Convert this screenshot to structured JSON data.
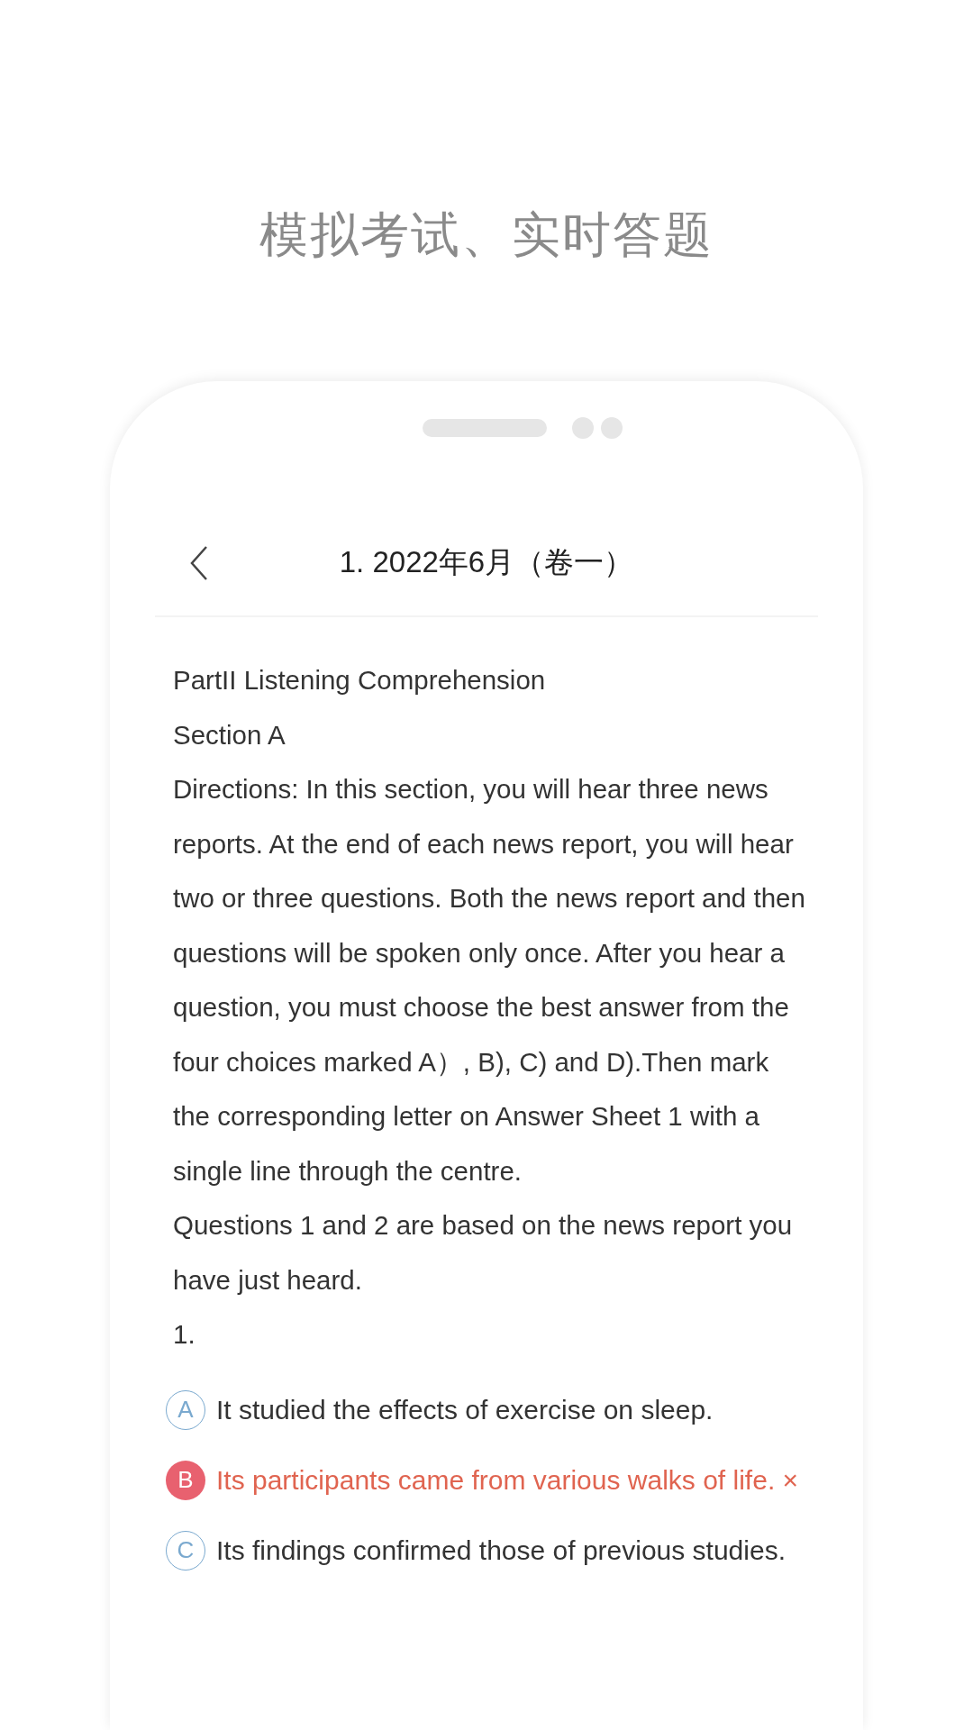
{
  "headline": "模拟考试、实时答题",
  "screen": {
    "title": "1. 2022年6月（卷一）",
    "paragraphs": [
      "PartII Listening Comprehension",
      "Section A",
      "Directions: In this section, you will hear three news reports. At the end of each news report, you will hear two or three questions. Both the news report and then questions will be spoken only once. After you hear a question, you must choose the best answer from the four choices marked A）, B), C) and D).Then mark the corresponding letter on Answer Sheet 1 with a single line through the centre.",
      "Questions 1 and 2 are based on the news report you have just heard.",
      "1."
    ],
    "options": [
      {
        "letter": "A",
        "text": "It studied the effects of exercise on sleep.",
        "selected": false
      },
      {
        "letter": "B",
        "text": "Its participants came from various walks of life. ×",
        "selected": true
      },
      {
        "letter": "C",
        "text": "Its findings confirmed those of previous studies.",
        "selected": false
      }
    ]
  }
}
